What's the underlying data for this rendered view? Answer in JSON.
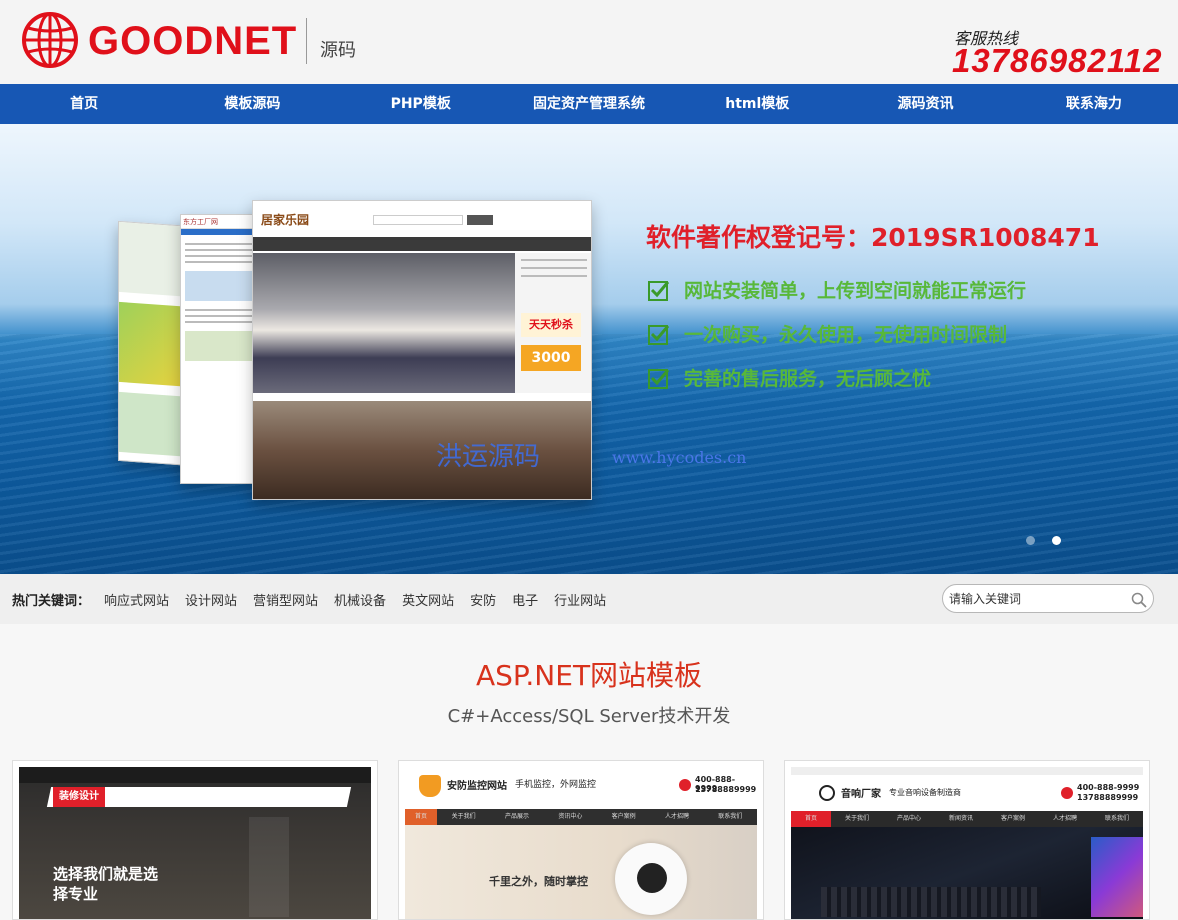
{
  "brand": {
    "name": "GOODNET",
    "subtitle": "源码",
    "hotline_label": "客服热线",
    "hotline_number": "13786982112",
    "brand_color": "#e0101a"
  },
  "nav": {
    "items": [
      "首页",
      "模板源码",
      "PHP模板",
      "固定资产管理系统",
      "html模板",
      "源码资讯",
      "联系海力"
    ],
    "background": "#1757b4"
  },
  "banner": {
    "title": "软件著作权登记号：2019SR1008471",
    "features": [
      "网站安装简单，上传到空间就能正常运行",
      "一次购买，永久使用，无使用时间限制",
      "完善的售后服务，无后顾之忧"
    ],
    "watermark_text": "洪运源码",
    "watermark_url": "www.hycodes.cn",
    "mockup_labels": {
      "front": "居家乐园",
      "front_badge": "天天秒杀",
      "front_price": "3000",
      "middle": "东方工厂网"
    },
    "slides": 2,
    "active_slide": 2
  },
  "keywords": {
    "label": "热门关键词：",
    "items": [
      "响应式网站",
      "设计网站",
      "营销型网站",
      "机械设备",
      "英文网站",
      "安防",
      "电子",
      "行业网站"
    ]
  },
  "search": {
    "placeholder": "请输入关键词",
    "icon": "search-icon"
  },
  "section": {
    "title": "ASP.NET网站模板",
    "subtitle": "C#+Access/SQL Server技术开发",
    "title_color": "#d8321c"
  },
  "cards": [
    {
      "brand": "装修设计",
      "tagline": "选择我们就是选",
      "tagline2": "择专业"
    },
    {
      "brand": "安防监控网站",
      "brand_sub": "手机监控，外网监控",
      "phone1": "400-888-9999",
      "phone2": "13788889999",
      "slogan": "千里之外，随时掌控",
      "nav": [
        "首页",
        "关于我们",
        "产品展示",
        "资讯中心",
        "客户案例",
        "人才招聘",
        "联系我们"
      ]
    },
    {
      "brand": "音响厂家",
      "brand_sub": "专业音响设备制造商",
      "phone1": "400-888-9999",
      "phone2": "13788889999",
      "nav": [
        "首页",
        "关于我们",
        "产品中心",
        "新闻资讯",
        "客户案例",
        "人才招聘",
        "联系我们"
      ]
    }
  ]
}
